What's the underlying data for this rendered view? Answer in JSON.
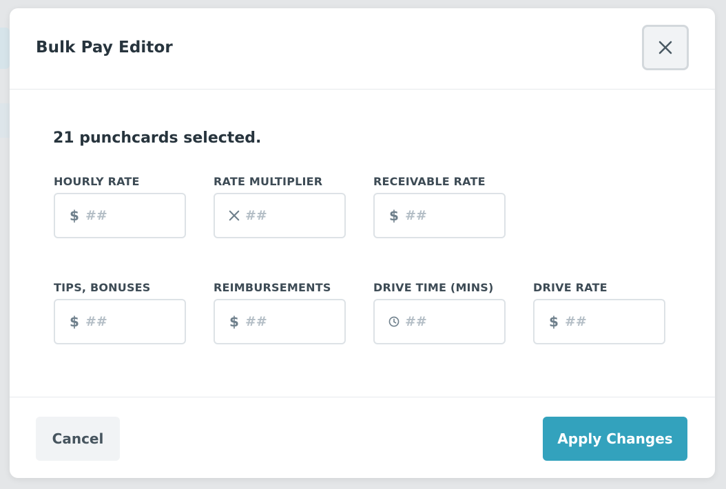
{
  "modal": {
    "title": "Bulk Pay Editor",
    "close_icon": "close-icon",
    "selection_text": "21 punchcards selected."
  },
  "fields": {
    "hourly_rate": {
      "label": "HOURLY RATE",
      "icon": "$",
      "placeholder": "##"
    },
    "rate_multiplier": {
      "label": "RATE MULTIPLIER",
      "icon": "multiply-icon",
      "placeholder": "##"
    },
    "receivable_rate": {
      "label": "RECEIVABLE RATE",
      "icon": "$",
      "placeholder": "##"
    },
    "tips_bonuses": {
      "label": "TIPS, BONUSES",
      "icon": "$",
      "placeholder": "##"
    },
    "reimbursements": {
      "label": "REIMBURSEMENTS",
      "icon": "$",
      "placeholder": "##"
    },
    "drive_time": {
      "label": "DRIVE TIME (MINS)",
      "icon": "clock-icon",
      "placeholder": "##"
    },
    "drive_rate": {
      "label": "DRIVE RATE",
      "icon": "$",
      "placeholder": "##"
    }
  },
  "footer": {
    "cancel_label": "Cancel",
    "apply_label": "Apply Changes"
  },
  "colors": {
    "accent": "#33a2bd",
    "text": "#27343d",
    "label": "#3d4b55",
    "icon": "#6e7f8b",
    "placeholder": "#b4bec6",
    "border": "#dde2e6"
  }
}
